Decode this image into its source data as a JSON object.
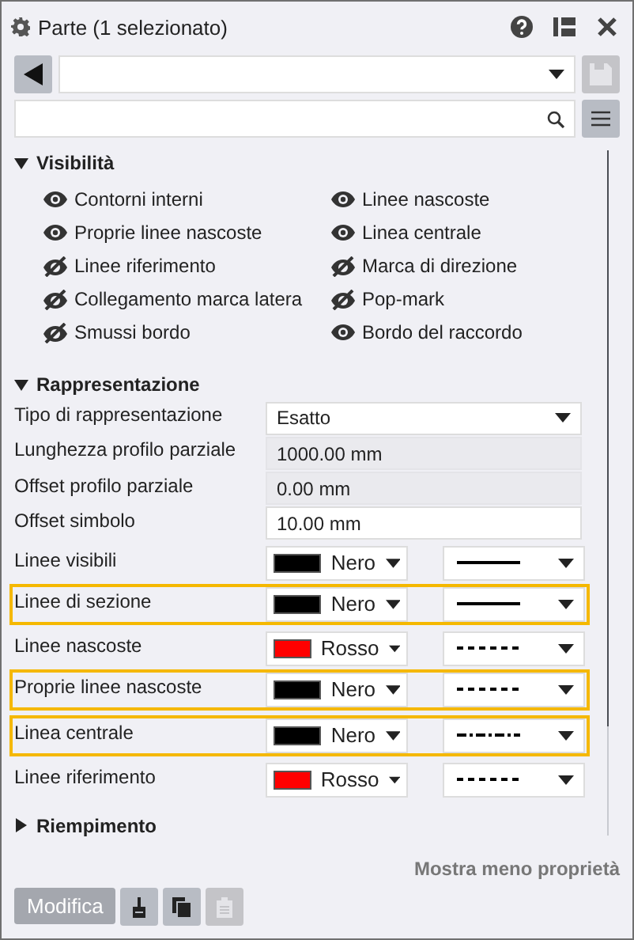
{
  "window": {
    "title": "Parte (1 selezionato)"
  },
  "toolbar": {
    "save_disabled": true
  },
  "visibility": {
    "title": "Visibilità",
    "expanded": true,
    "items": [
      {
        "label": "Contorni interni",
        "visible": true
      },
      {
        "label": "Linee nascoste",
        "visible": true
      },
      {
        "label": "Proprie linee nascoste",
        "visible": true
      },
      {
        "label": "Linea centrale",
        "visible": true
      },
      {
        "label": "Linee riferimento",
        "visible": false
      },
      {
        "label": "Marca di direzione",
        "visible": false
      },
      {
        "label": "Collegamento marca latera",
        "visible": false
      },
      {
        "label": "Pop-mark",
        "visible": false
      },
      {
        "label": "Smussi bordo",
        "visible": false
      },
      {
        "label": "Bordo del raccordo",
        "visible": true
      }
    ]
  },
  "representation": {
    "title": "Rappresentazione",
    "expanded": true,
    "fields": [
      {
        "label": "Tipo di rappresentazione",
        "value": "Esatto",
        "kind": "select"
      },
      {
        "label": "Lunghezza profilo parziale",
        "value": "1000.00 mm",
        "kind": "readonly"
      },
      {
        "label": "Offset profilo parziale",
        "value": "0.00 mm",
        "kind": "readonly"
      },
      {
        "label": "Offset simbolo",
        "value": "10.00 mm",
        "kind": "input"
      }
    ],
    "lines": [
      {
        "label": "Linee visibili",
        "color_name": "Nero",
        "color": "#000000",
        "kind": "solid",
        "highlighted": false
      },
      {
        "label": "Linee di sezione",
        "color_name": "Nero",
        "color": "#000000",
        "kind": "solid",
        "highlighted": true
      },
      {
        "label": "Linee nascoste",
        "color_name": "Rosso",
        "color": "#ff0000",
        "kind": "dashed",
        "highlighted": false
      },
      {
        "label": "Proprie linee nascoste",
        "color_name": "Nero",
        "color": "#000000",
        "kind": "dashed",
        "highlighted": true
      },
      {
        "label": "Linea centrale",
        "color_name": "Nero",
        "color": "#000000",
        "kind": "dashdot",
        "highlighted": true
      },
      {
        "label": "Linee riferimento",
        "color_name": "Rosso",
        "color": "#ff0000",
        "kind": "dashed",
        "highlighted": false
      }
    ]
  },
  "filling": {
    "title": "Riempimento",
    "expanded": false
  },
  "show_less_link": "Mostra meno proprietà",
  "footer": {
    "modify_label": "Modifica",
    "modify_disabled": true,
    "paste_disabled": true
  }
}
